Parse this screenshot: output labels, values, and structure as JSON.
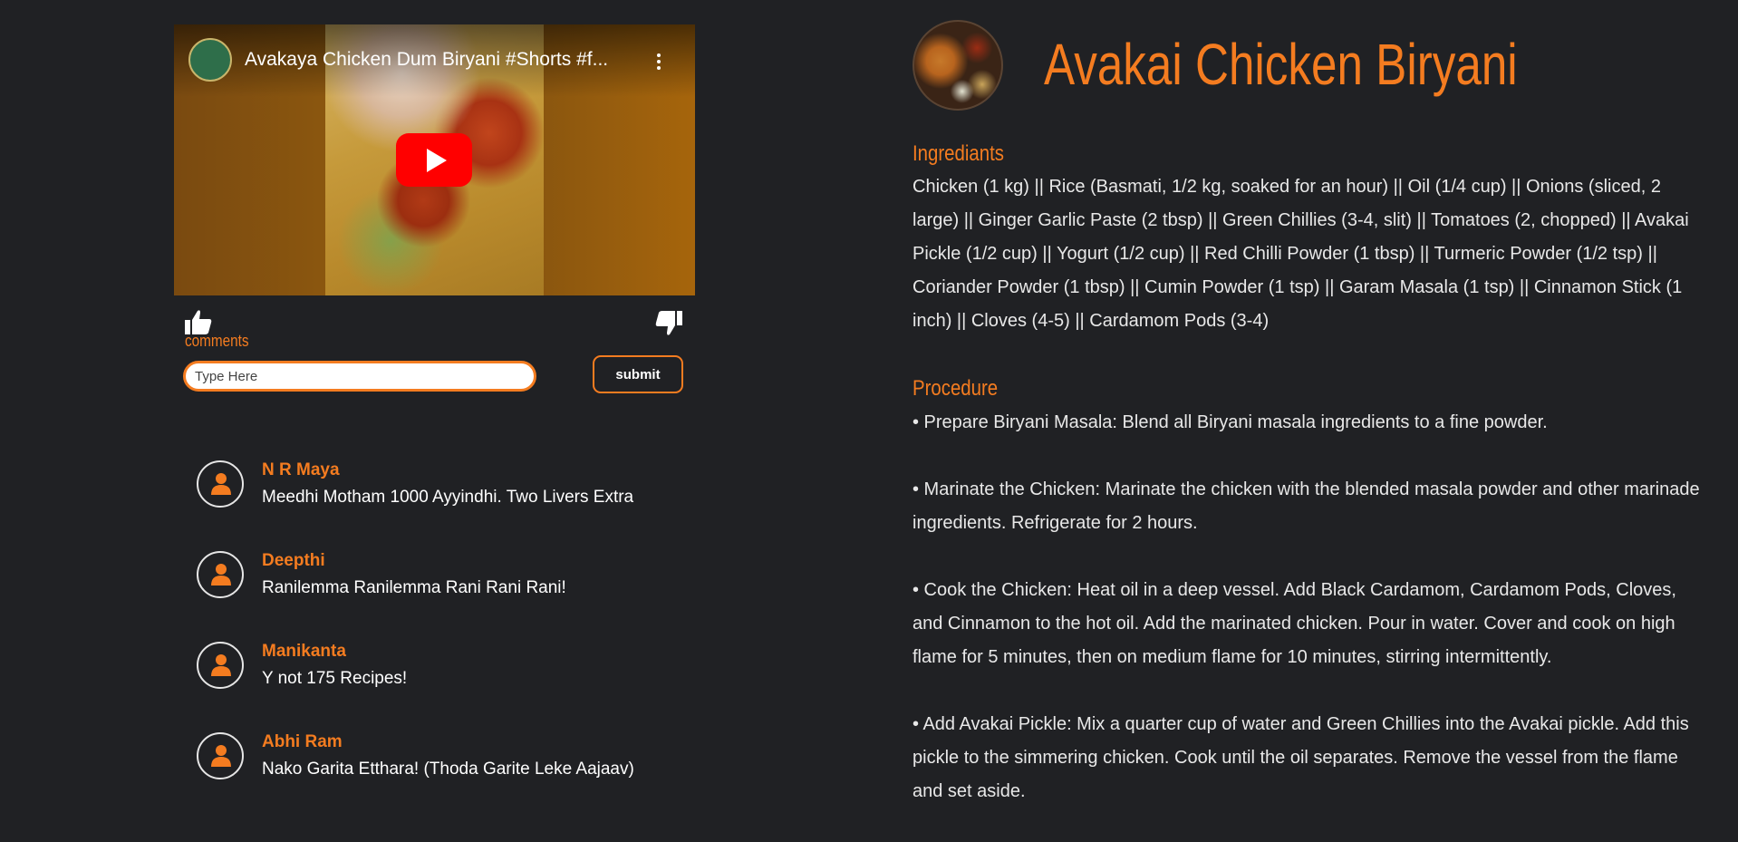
{
  "video": {
    "title": "Avakaya Chicken Dum Biryani #Shorts #f..."
  },
  "comments_section": {
    "label": "comments",
    "input_placeholder": "Type Here",
    "submit_label": "submit",
    "items": [
      {
        "name": "N R Maya",
        "text": "Meedhi Motham 1000 Ayyindhi. Two Livers Extra"
      },
      {
        "name": "Deepthi",
        "text": "Ranilemma Ranilemma Rani Rani Rani!"
      },
      {
        "name": "Manikanta",
        "text": "Y not 175 Recipes!"
      },
      {
        "name": "Abhi Ram",
        "text": "Nako Garita Etthara! (Thoda Garite Leke Aajaav)"
      }
    ]
  },
  "recipe": {
    "title": "Avakai Chicken Biryani",
    "ingredients_label": "Ingrediants",
    "ingredients": "Chicken (1 kg) || Rice (Basmati, 1/2 kg, soaked for an hour) || Oil (1/4 cup) || Onions (sliced, 2 large) || Ginger Garlic Paste (2 tbsp) || Green Chillies (3-4, slit) || Tomatoes (2, chopped) || Avakai Pickle (1/2 cup) || Yogurt (1/2 cup) || Red Chilli Powder (1 tbsp) || Turmeric Powder (1/2 tsp) || Coriander Powder (1 tbsp) || Cumin Powder (1 tsp) || Garam Masala (1 tsp) || Cinnamon Stick (1 inch) || Cloves (4-5) || Cardamom Pods (3-4)",
    "procedure_label": "Procedure",
    "steps": [
      "• Prepare Biryani Masala: Blend all Biryani masala ingredients to a fine powder.",
      "• Marinate the Chicken: Marinate the chicken with the blended masala powder and other marinade ingredients. Refrigerate for 2 hours.",
      "• Cook the Chicken: Heat oil in a deep vessel. Add Black Cardamom, Cardamom Pods, Cloves, and Cinnamon to the hot oil. Add the marinated chicken. Pour in water. Cover and cook on high flame for 5 minutes, then on medium flame for 10 minutes, stirring intermittently.",
      "• Add Avakai Pickle: Mix a quarter cup of water and Green Chillies into the Avakai pickle. Add this pickle to the simmering chicken. Cook until the oil separates. Remove the vessel from the flame and set aside."
    ]
  },
  "colors": {
    "accent": "#f47c20",
    "background": "#202124"
  }
}
